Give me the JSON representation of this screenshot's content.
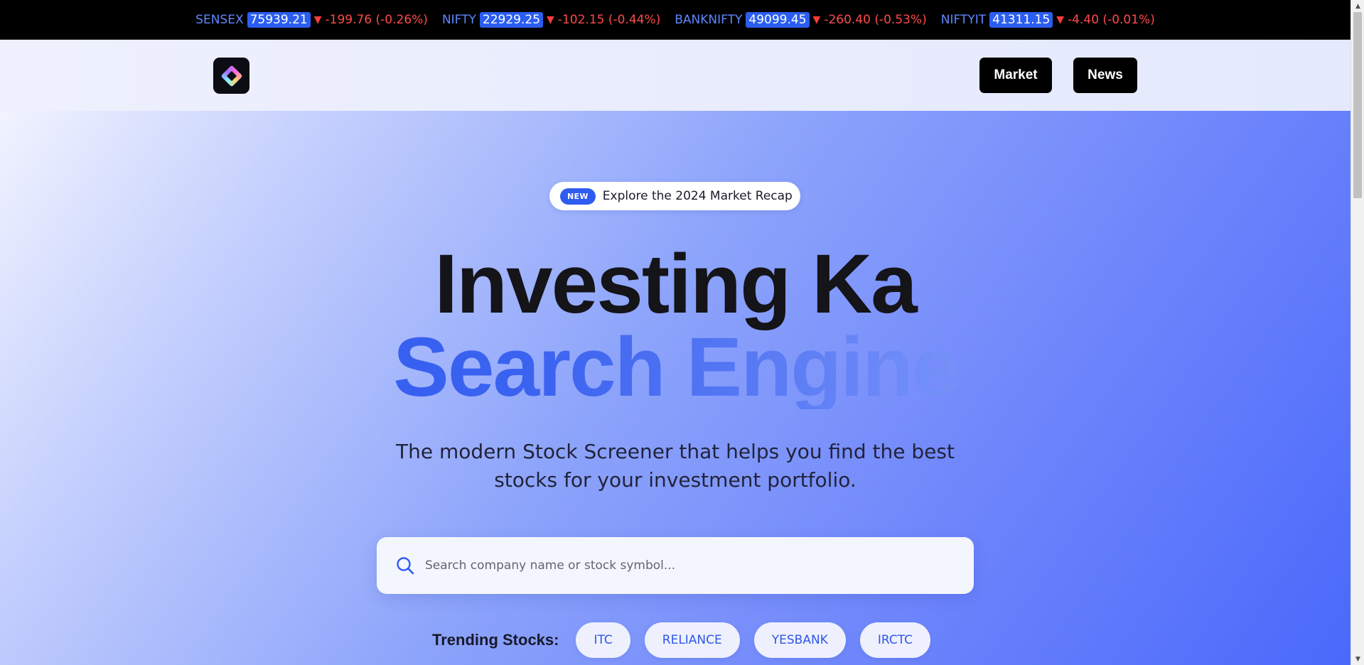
{
  "ticker": [
    {
      "symbol": "SENSEX",
      "price": "75939.21",
      "change": "-199.76 (-0.26%)"
    },
    {
      "symbol": "NIFTY",
      "price": "22929.25",
      "change": "-102.15 (-0.44%)"
    },
    {
      "symbol": "BANKNIFTY",
      "price": "49099.45",
      "change": "-260.40 (-0.53%)"
    },
    {
      "symbol": "NIFTYIT",
      "price": "41311.15",
      "change": "-4.40 (-0.01%)"
    }
  ],
  "nav": {
    "market_label": "Market",
    "news_label": "News"
  },
  "hero": {
    "badge_new": "NEW",
    "badge_text": "Explore the 2024 Market Recap",
    "headline_line1": "Investing Ka",
    "headline_line2": "Search Engine",
    "subtitle": "The modern Stock Screener that helps you find the best stocks for your investment portfolio.",
    "search_placeholder": "Search company name or stock symbol...",
    "trending_label": "Trending Stocks:",
    "trending": [
      "ITC",
      "RELIANCE",
      "YESBANK",
      "IRCTC"
    ]
  },
  "icons": {
    "down_arrow": "triangle-down-icon",
    "search": "search-icon",
    "logo": "diamond-logo-icon"
  },
  "colors": {
    "ticker_bg": "#000000",
    "symbol": "#5e87ff",
    "price_bg": "#2b5ef0",
    "negative": "#ff4a4a",
    "accent": "#2f5cf0"
  }
}
